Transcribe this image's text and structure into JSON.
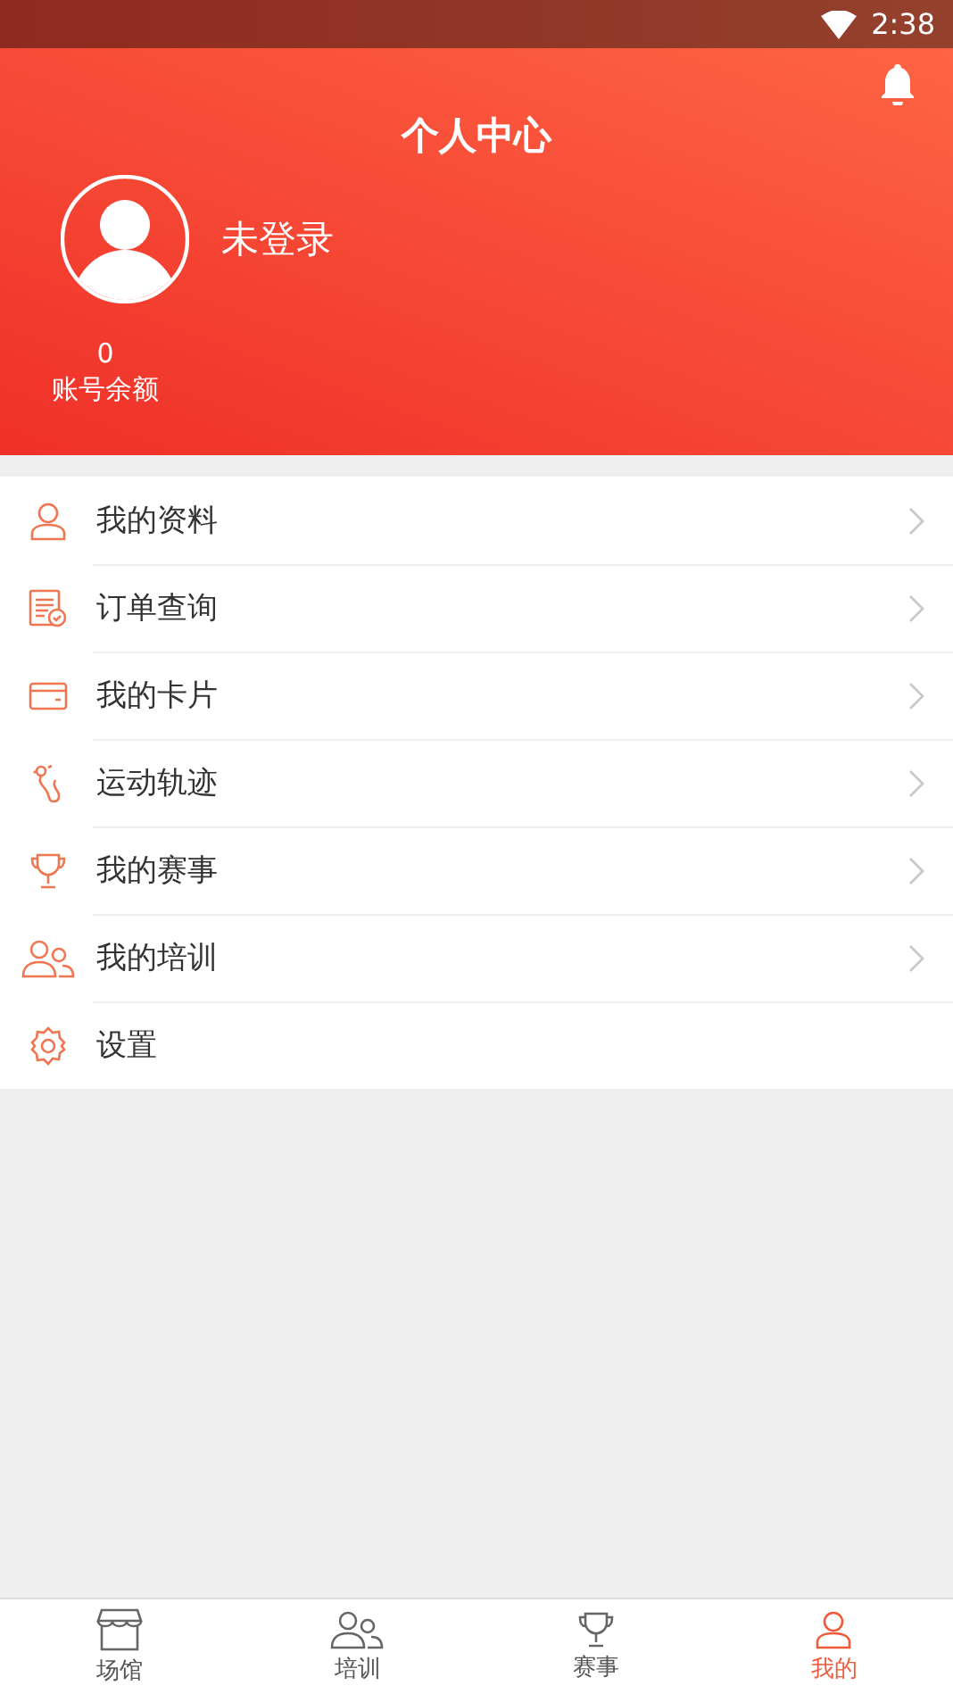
{
  "status_bar": {
    "time": "2:38"
  },
  "header": {
    "title": "个人中心",
    "user_name": "未登录",
    "balance": "0",
    "balance_label": "账号余额"
  },
  "menu": [
    {
      "kind": "person",
      "label": "我的资料",
      "chevron": true
    },
    {
      "kind": "order",
      "label": "订单查询",
      "chevron": true
    },
    {
      "kind": "card",
      "label": "我的卡片",
      "chevron": true
    },
    {
      "kind": "track",
      "label": "运动轨迹",
      "chevron": true
    },
    {
      "kind": "trophy",
      "label": "我的赛事",
      "chevron": true
    },
    {
      "kind": "people",
      "label": "我的培训",
      "chevron": true
    },
    {
      "kind": "gear",
      "label": "设置",
      "chevron": false
    }
  ],
  "tab_bar": [
    {
      "kind": "store",
      "label": "场馆",
      "selected": false
    },
    {
      "kind": "people",
      "label": "培训",
      "selected": false
    },
    {
      "kind": "trophy",
      "label": "赛事",
      "selected": false
    },
    {
      "kind": "person",
      "label": "我的",
      "selected": true
    }
  ]
}
